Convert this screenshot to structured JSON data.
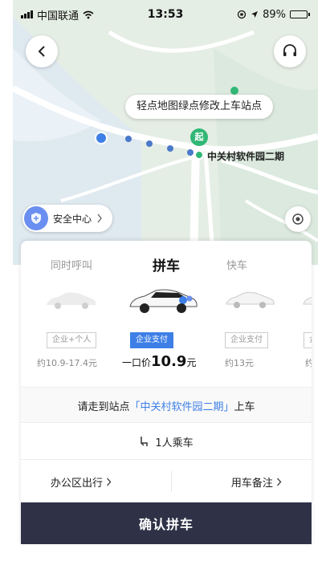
{
  "status_bar": {
    "carrier": "中国联通",
    "time": "13:53",
    "battery": "89%",
    "battery_level": 0.89
  },
  "map": {
    "tooltip": "轻点地图绿点修改上车站点",
    "start_pin": "起",
    "station_label": "中关村软件园二期"
  },
  "safety": {
    "label": "安全中心"
  },
  "tabs": [
    {
      "label": "同时呼叫"
    },
    {
      "label": "拼车"
    },
    {
      "label": "快车"
    }
  ],
  "options": [
    {
      "tag": "企业+个人",
      "price": "约10.9-17.4元"
    },
    {
      "tag": "企业支付",
      "price_prefix": "一口价",
      "price_value": "10.9",
      "price_unit": "元"
    },
    {
      "tag": "企业支付",
      "price": "约13元"
    },
    {
      "tag": "企",
      "price": "约"
    }
  ],
  "station_row": {
    "prefix": "请走到站点",
    "station": "「中关村软件园二期」",
    "suffix": "上车"
  },
  "passengers": "1人乘车",
  "extra": {
    "office": "办公区出行",
    "note": "用车备注"
  },
  "confirm_label": "确认拼车",
  "colors": {
    "accent": "#3d7fe6",
    "green": "#32b776",
    "dark": "#2f3247"
  }
}
